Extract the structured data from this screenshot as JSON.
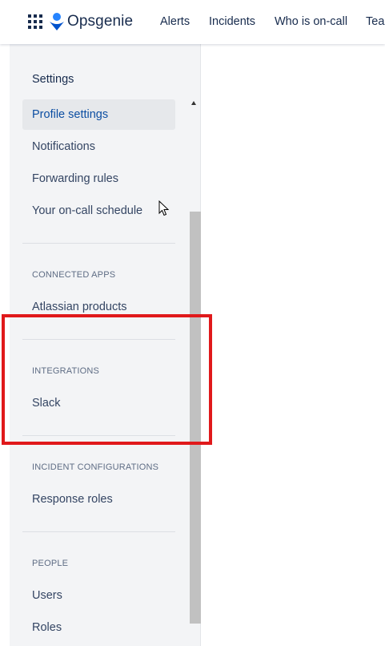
{
  "topbar": {
    "brand": "Opsgenie",
    "nav": [
      "Alerts",
      "Incidents",
      "Who is on-call",
      "Teams"
    ]
  },
  "sidebar": {
    "title": "Settings",
    "items": [
      {
        "label": "Profile settings"
      },
      {
        "label": "Notifications"
      },
      {
        "label": "Forwarding rules"
      },
      {
        "label": "Your on-call schedule"
      }
    ],
    "sections": [
      {
        "heading": "CONNECTED APPS",
        "items": [
          {
            "label": "Atlassian products"
          }
        ]
      },
      {
        "heading": "INTEGRATIONS",
        "items": [
          {
            "label": "Slack"
          }
        ]
      },
      {
        "heading": "INCIDENT CONFIGURATIONS",
        "items": [
          {
            "label": "Response roles"
          }
        ]
      },
      {
        "heading": "PEOPLE",
        "items": [
          {
            "label": "Users"
          },
          {
            "label": "Roles"
          }
        ]
      }
    ]
  },
  "colors": {
    "accent": "#0c4ea2",
    "highlight": "#e0191b",
    "sidebar_bg": "#f3f4f6"
  }
}
